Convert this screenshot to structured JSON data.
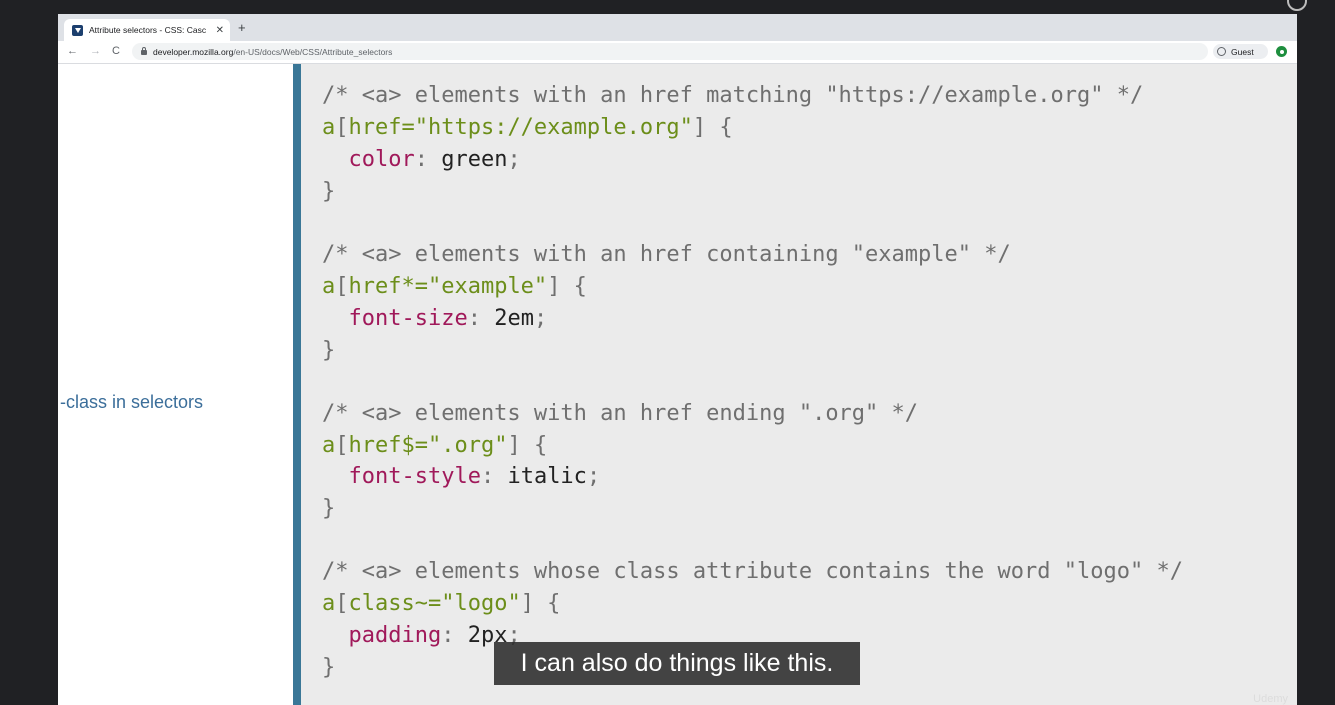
{
  "browser": {
    "tab_title": "Attribute selectors - CSS: Casc",
    "tab_close": "✕",
    "new_tab": "+",
    "nav_back": "←",
    "nav_forward": "→",
    "nav_reload": "C",
    "url_host": "developer.mozilla.org",
    "url_path": "/en-US/docs/Web/CSS/Attribute_selectors",
    "profile_label": "Guest"
  },
  "sidebar": {
    "link_text": "-class in selectors"
  },
  "code": {
    "block1": {
      "comment": "/* <a> elements with an href matching \"https://example.org\" */",
      "selector_a": "a",
      "bracket_open": "[",
      "attr": "href=\"https://example.org\"",
      "bracket_close": "]",
      "brace_open": " {",
      "property": "color",
      "colon": ": ",
      "value": "green",
      "semicolon": ";",
      "brace_close": "}"
    },
    "block2": {
      "comment": "/* <a> elements with an href containing \"example\" */",
      "selector_a": "a",
      "bracket_open": "[",
      "attr": "href*=\"example\"",
      "bracket_close": "]",
      "brace_open": " {",
      "property": "font-size",
      "colon": ": ",
      "value": "2em",
      "semicolon": ";",
      "brace_close": "}"
    },
    "block3": {
      "comment": "/* <a> elements with an href ending \".org\" */",
      "selector_a": "a",
      "bracket_open": "[",
      "attr": "href$=\".org\"",
      "bracket_close": "]",
      "brace_open": " {",
      "property": "font-style",
      "colon": ": ",
      "value": "italic",
      "semicolon": ";",
      "brace_close": "}"
    },
    "block4": {
      "comment": "/* <a> elements whose class attribute contains the word \"logo\" */",
      "selector_a": "a",
      "bracket_open": "[",
      "attr": "class~=\"logo\"",
      "bracket_close": "]",
      "brace_open": " {",
      "property": "padding",
      "colon": ": ",
      "value": "2px",
      "semicolon": ";",
      "brace_close": "}"
    }
  },
  "caption": {
    "text": "I can also do things like this."
  },
  "watermark": {
    "text": "Udemy"
  }
}
